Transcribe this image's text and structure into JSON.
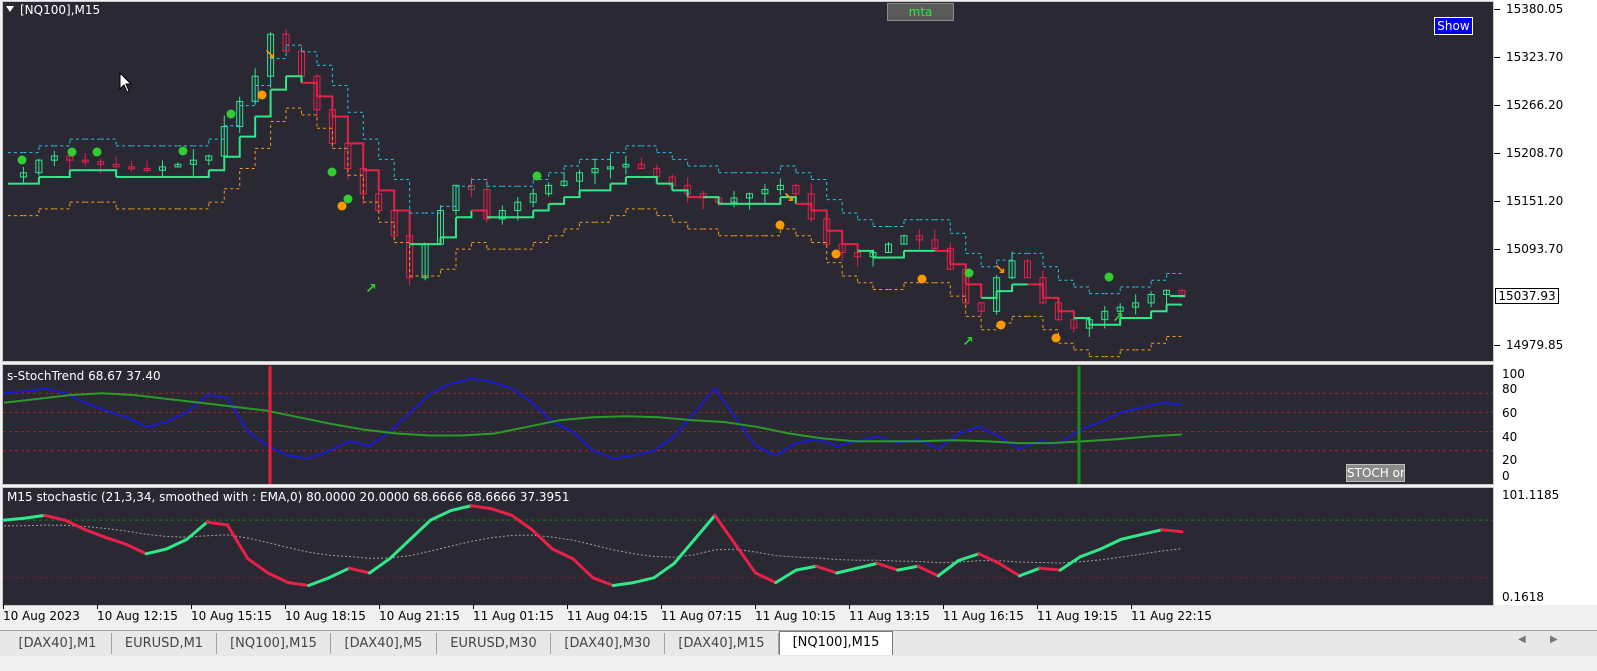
{
  "chart": {
    "symbol_label": "[NQ100],M15",
    "mta_label": "mta",
    "show_label": "Show",
    "current_price": "15037.93",
    "colors": {
      "bg": "#2a2832",
      "bull": "#2fe88a",
      "bear": "#e8204a",
      "upper": "#22c7e8",
      "lower": "#f0a020",
      "dot_green": "#33cc33",
      "dot_orange": "#ff9900",
      "stoch_blue": "#1a1ad0",
      "stoch_green": "#2a9a2a",
      "vline_red": "#e8203a",
      "vline_green": "#1a8a1a"
    }
  },
  "price_axis": [
    "15380.05",
    "15323.70",
    "15266.20",
    "15208.70",
    "15151.20",
    "15093.70",
    "14979.85"
  ],
  "stoch_pane": {
    "title": "s-StochTrend 68.67 37.40",
    "levels": [
      "100",
      "80",
      "60",
      "40",
      "20",
      "0"
    ],
    "button_label": "STOCH on"
  },
  "m15_pane": {
    "title": "M15 stochastic (21,3,34, smoothed with : EMA,0) 80.0000 20.0000 68.6666 68.6666 37.3951",
    "levels": [
      "101.1185",
      "0.1618"
    ]
  },
  "time_axis": [
    "10 Aug 2023",
    "10 Aug 12:15",
    "10 Aug 15:15",
    "10 Aug 18:15",
    "10 Aug 21:15",
    "11 Aug 01:15",
    "11 Aug 04:15",
    "11 Aug 07:15",
    "11 Aug 10:15",
    "11 Aug 13:15",
    "11 Aug 16:15",
    "11 Aug 19:15",
    "11 Aug 22:15"
  ],
  "tabs": [
    "[DAX40],M1",
    "EURUSD,M1",
    "[NQ100],M15",
    "[DAX40],M5",
    "EURUSD,M30",
    "[DAX40],M30",
    "[DAX40],M15",
    "[NQ100],M15"
  ],
  "active_tab_index": 7,
  "chart_data": {
    "type": "candlestick",
    "price_series_approx": [
      15180,
      15185,
      15200,
      15205,
      15200,
      15198,
      15195,
      15192,
      15190,
      15188,
      15192,
      15195,
      15200,
      15205,
      15240,
      15270,
      15300,
      15350,
      15330,
      15300,
      15260,
      15220,
      15190,
      15160,
      15140,
      15110,
      15060,
      15100,
      15140,
      15170,
      15165,
      15130,
      15140,
      15150,
      15160,
      15170,
      15175,
      15185,
      15190,
      15192,
      15195,
      15190,
      15180,
      15170,
      15160,
      15155,
      15150,
      15155,
      15160,
      15165,
      15170,
      15160,
      15130,
      15100,
      15090,
      15085,
      15090,
      15100,
      15110,
      15105,
      15095,
      15070,
      15030,
      15020,
      15060,
      15080,
      15060,
      15030,
      15010,
      15000,
      15010,
      15020,
      15025,
      15030,
      15040,
      15045,
      15037
    ],
    "stoch_series_approx": [
      80,
      82,
      85,
      80,
      70,
      62,
      55,
      45,
      50,
      60,
      78,
      75,
      40,
      25,
      15,
      12,
      20,
      30,
      25,
      40,
      60,
      80,
      90,
      95,
      92,
      85,
      70,
      50,
      40,
      20,
      12,
      15,
      20,
      35,
      60,
      85,
      55,
      25,
      15,
      28,
      32,
      25,
      30,
      35,
      28,
      32,
      22,
      38,
      45,
      35,
      22,
      30,
      28,
      42,
      50,
      60,
      65,
      70,
      68
    ],
    "trend_series_approx": [
      70,
      74,
      78,
      80,
      78,
      74,
      70,
      66,
      62,
      55,
      48,
      42,
      38,
      36,
      36,
      38,
      45,
      52,
      55,
      56,
      55,
      52,
      50,
      45,
      38,
      33,
      30,
      30,
      30,
      31,
      30,
      28,
      28,
      30,
      32,
      35,
      37
    ]
  }
}
